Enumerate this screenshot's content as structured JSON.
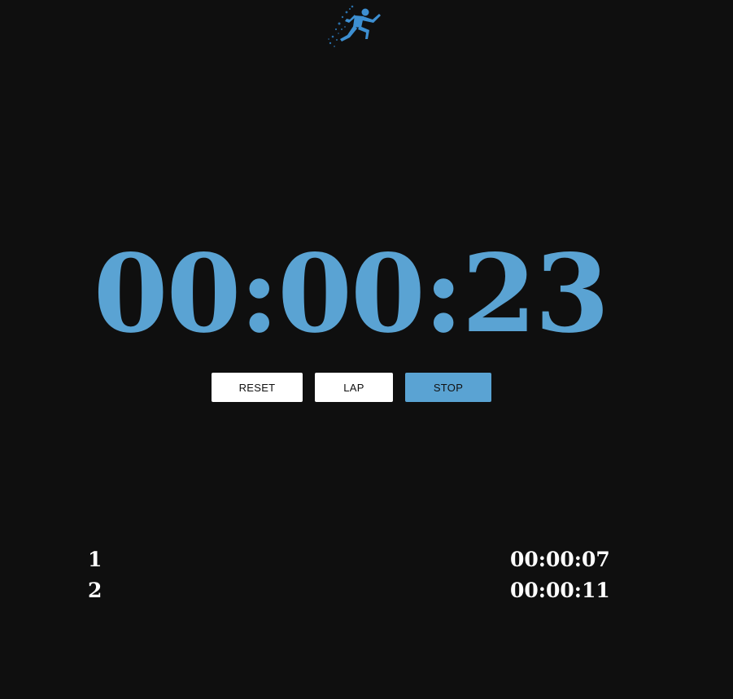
{
  "logo": {
    "icon": "runner-icon",
    "color": "#3d8fd1"
  },
  "timer": {
    "display": "00:00:23",
    "color": "#5aa3d3"
  },
  "controls": {
    "reset_label": "RESET",
    "lap_label": "LAP",
    "stop_label": "STOP",
    "accent": "#5aa3d3"
  },
  "laps": [
    {
      "number": "1",
      "time": "00:00:07"
    },
    {
      "number": "2",
      "time": "00:00:11"
    }
  ]
}
